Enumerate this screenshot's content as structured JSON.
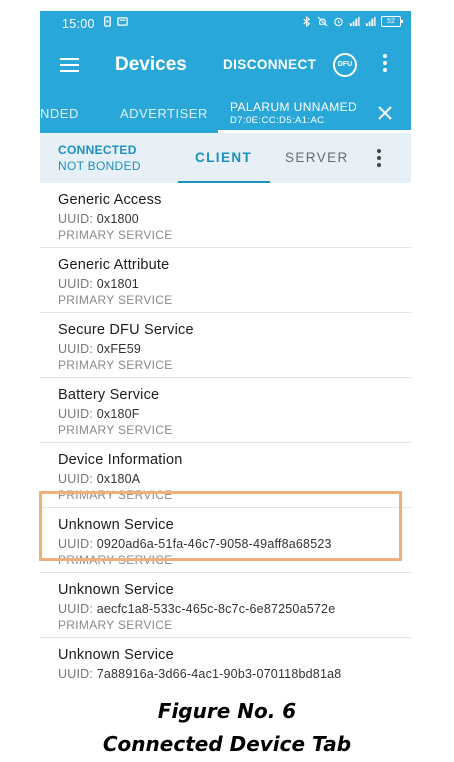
{
  "status_bar": {
    "time": "15:00",
    "battery": "52"
  },
  "app_bar": {
    "title": "Devices",
    "disconnect_label": "DISCONNECT",
    "dfu_label": "DFU"
  },
  "device_tabs": {
    "tab_partial": "NDED",
    "tab_advertiser": "ADVERTISER",
    "active_name": "PALARUM UNNAMED",
    "active_address": "D7:0E:CC:D5:A1:AC"
  },
  "connection": {
    "state": "CONNECTED",
    "bond": "NOT BONDED",
    "tab_client": "CLIENT",
    "tab_server": "SERVER"
  },
  "uuid_label": "UUID:",
  "services": [
    {
      "name": "Generic Access",
      "uuid": "0x1800",
      "type": "PRIMARY SERVICE"
    },
    {
      "name": "Generic Attribute",
      "uuid": "0x1801",
      "type": "PRIMARY SERVICE"
    },
    {
      "name": "Secure DFU Service",
      "uuid": "0xFE59",
      "type": "PRIMARY SERVICE"
    },
    {
      "name": "Battery Service",
      "uuid": "0x180F",
      "type": "PRIMARY SERVICE"
    },
    {
      "name": "Device Information",
      "uuid": "0x180A",
      "type": "PRIMARY SERVICE"
    },
    {
      "name": "Unknown Service",
      "uuid": "0920ad6a-51fa-46c7-9058-49aff8a68523",
      "type": "PRIMARY SERVICE"
    },
    {
      "name": "Unknown Service",
      "uuid": "aecfc1a8-533c-465c-8c7c-6e87250a572e",
      "type": "PRIMARY SERVICE"
    },
    {
      "name": "Unknown Service",
      "uuid": "7a88916a-3d66-4ac1-90b3-070118bd81a8",
      "type": ""
    }
  ],
  "caption": {
    "line1": "Figure No. 6",
    "line2": "Connected Device Tab"
  },
  "colors": {
    "app_bar": "#2aa7d9",
    "accent": "#1d8fbe",
    "highlight": "#f0b07a"
  }
}
